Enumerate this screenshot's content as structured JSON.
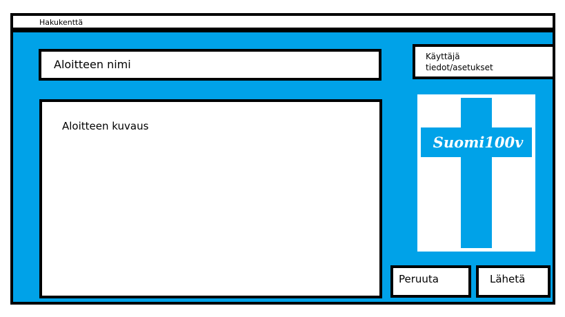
{
  "search": {
    "label": "Hakukenttä"
  },
  "form": {
    "title_placeholder": "Aloitteen nimi",
    "description_placeholder": "Aloitteen kuvaus"
  },
  "user": {
    "settings_label": "Käyttäjä\ntiedot/asetukset"
  },
  "logo": {
    "text": "Suomi100v",
    "cross_color": "#00a2e8",
    "text_color": "#ffffff"
  },
  "actions": {
    "cancel_label": "Peruuta",
    "submit_label": "Lähetä"
  },
  "colors": {
    "accent": "#00a2e8",
    "border": "#000000",
    "field_background": "#ffffff"
  }
}
